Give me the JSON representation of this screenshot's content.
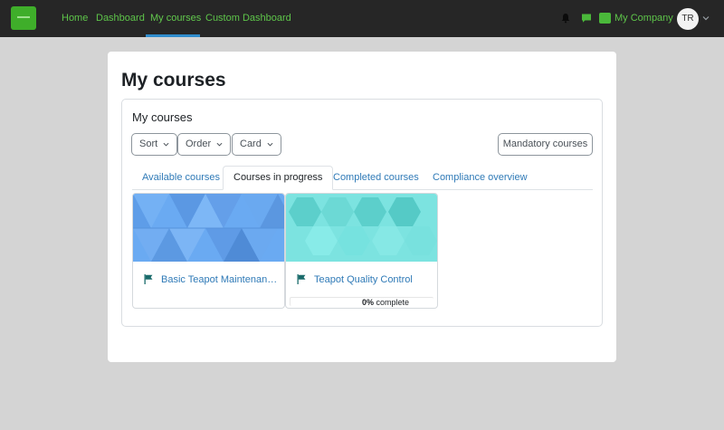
{
  "nav": {
    "links": [
      "Home",
      "Dashboard",
      "My courses",
      "Custom Dashboard"
    ],
    "active": "My courses",
    "company": "My Company",
    "avatar_initials": "TR"
  },
  "page": {
    "title": "My courses",
    "block_title": "My courses"
  },
  "controls": {
    "sort": "Sort",
    "order": "Order",
    "view": "Card",
    "mandatory": "Mandatory courses"
  },
  "tabs": [
    "Available courses",
    "Courses in progress",
    "Completed courses",
    "Compliance overview"
  ],
  "active_tab": "Courses in progress",
  "courses": [
    {
      "name": "Basic Teapot Maintenance (…",
      "image": "blue-triangle-pattern",
      "progress": null
    },
    {
      "name": "Teapot Quality Control",
      "image": "teal-hexagon-pattern",
      "progress": {
        "value": 0,
        "percent_label": "0%",
        "suffix": " complete"
      }
    }
  ],
  "colors": {
    "navbar_bg": "#262626",
    "nav_text": "#5ec54a",
    "link": "#2f7ab7",
    "page_bg": "#d4d4d4",
    "accent_underline": "#2f8ccc",
    "flag": "#1a6b6b"
  },
  "icons": {
    "logo": "company-logo",
    "bell": "bell-icon",
    "chat": "chat-icon",
    "flag": "flag-icon",
    "caret": "chevron-down-icon"
  }
}
